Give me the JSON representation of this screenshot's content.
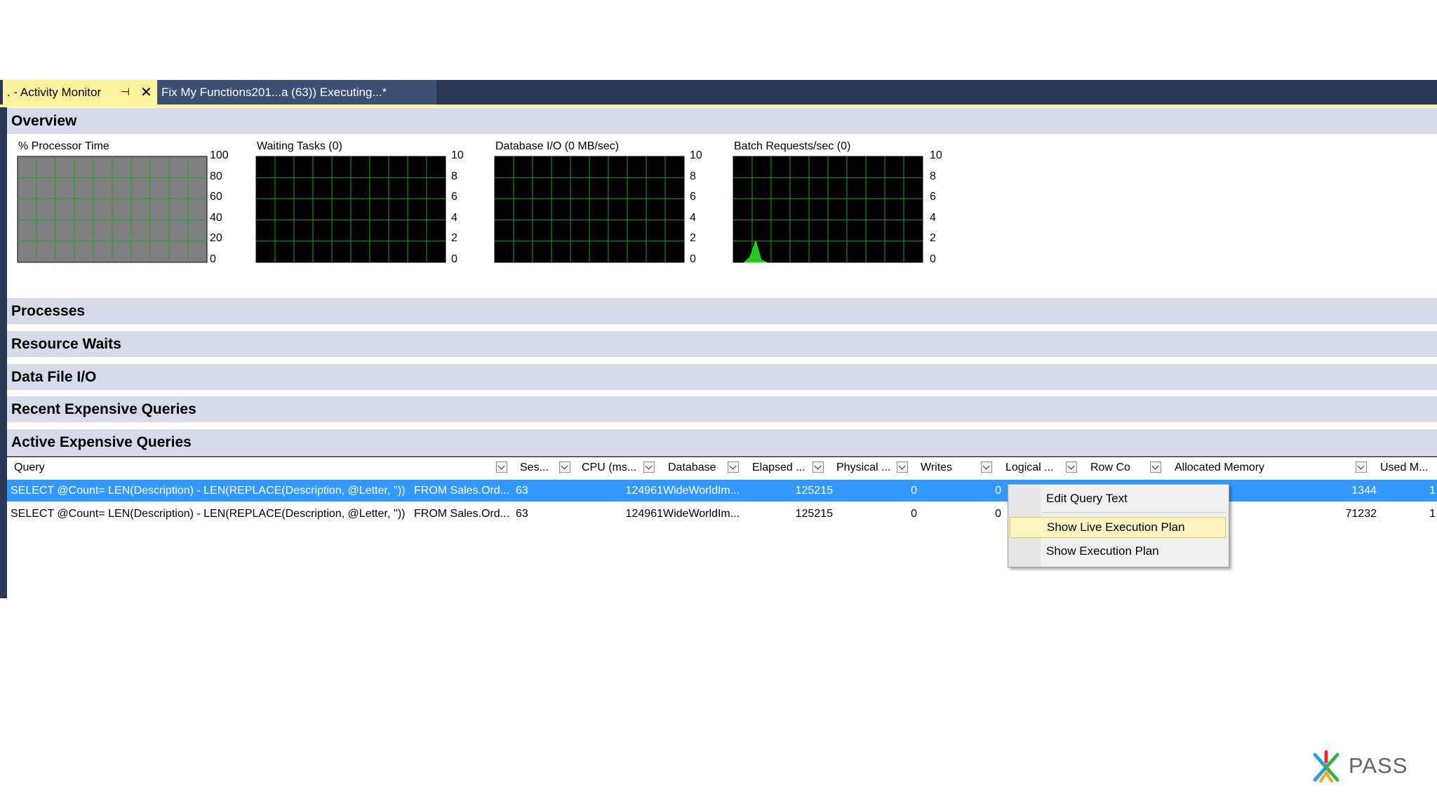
{
  "tabs": [
    {
      "label": ". - Activity Monitor",
      "active": true
    },
    {
      "label": "Fix My Functions201...a (63)) Executing...*",
      "active": false
    }
  ],
  "sections": {
    "overview": "Overview",
    "processes": "Processes",
    "resource_waits": "Resource Waits",
    "data_file_io": "Data File I/O",
    "recent_expensive": "Recent Expensive Queries",
    "active_expensive": "Active Expensive Queries"
  },
  "graphs": [
    {
      "title": "% Processor Time",
      "ticks": [
        "100",
        "80",
        "60",
        "40",
        "20",
        "0"
      ],
      "background": "#808080",
      "values": [
        0
      ]
    },
    {
      "title": "Waiting Tasks (0)",
      "ticks": [
        "10",
        "8",
        "6",
        "4",
        "2",
        "0"
      ],
      "background": "#000000",
      "values": [
        0
      ]
    },
    {
      "title": "Database I/O (0 MB/sec)",
      "ticks": [
        "10",
        "8",
        "6",
        "4",
        "2",
        "0"
      ],
      "background": "#000000",
      "values": [
        0
      ]
    },
    {
      "title": "Batch Requests/sec (0)",
      "ticks": [
        "10",
        "8",
        "6",
        "4",
        "2",
        "0"
      ],
      "background": "#000000",
      "values": [
        0,
        0.5,
        2,
        0.2,
        0
      ]
    }
  ],
  "grid": {
    "columns": [
      "Query",
      "Ses...",
      "CPU (ms...",
      "Database",
      "Elapsed ...",
      "Physical ...",
      "Writes",
      "Logical ...",
      "Row Co",
      "Allocated Memory",
      "Used M..."
    ],
    "rows": [
      {
        "query": "SELECT @Count= LEN(Description) - LEN(REPLACE(Description, @Letter, ''))",
        "query_tail": "FROM Sales.Ord...",
        "session": "63",
        "cpu": "124961",
        "database": "WideWorldIm...",
        "elapsed": "125215",
        "physical": "0",
        "writes": "0",
        "allocated": "1344",
        "used": "1",
        "selected": true
      },
      {
        "query": "SELECT @Count= LEN(Description) - LEN(REPLACE(Description, @Letter, ''))",
        "query_tail": "FROM Sales.Ord...",
        "session": "63",
        "cpu": "124961",
        "database": "WideWorldIm...",
        "elapsed": "125215",
        "physical": "0",
        "writes": "0",
        "allocated": "71232",
        "used": "1",
        "selected": false
      }
    ]
  },
  "context_menu": {
    "items": [
      "Edit Query Text",
      "Show Live Execution Plan",
      "Show Execution Plan"
    ],
    "highlighted": "Show Live Execution Plan"
  },
  "logo": {
    "text": "PASS"
  },
  "colors": {
    "tab_strip": "#293955",
    "active_tab": "#fff29d",
    "section_bar": "#d5dbe9",
    "selection": "#3399ff",
    "graph_grid": "#1fa01f"
  }
}
